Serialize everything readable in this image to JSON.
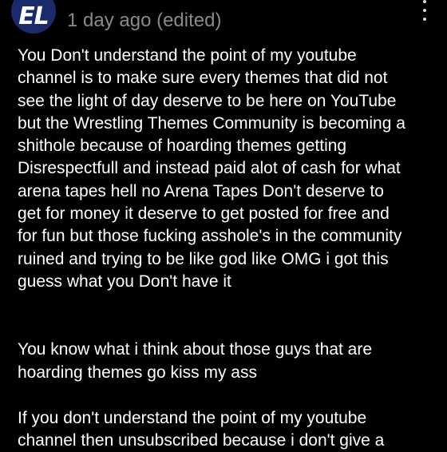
{
  "comment": {
    "avatar_initials": "EL",
    "author": "",
    "meta": "1 day ago (edited)",
    "menu_icon": "more-vertical-icon",
    "paragraphs": [
      "You Don't understand the point of my youtube\nchannel is to make sure every themes that did not\nsee the light of day deserve to be here on YouTube\nbut the Wrestling Themes Community is becoming a\nshithole because of hoarding themes getting\nDisrespectfull and instead paid alot of cash for what\narena tapes hell no Arena Tapes Don't deserve to\nget for money it deserve to get posted for free and\nfor fun but those fucking asshole's in the community\nruined and trying to be like god like OMG i got this\nguess what you Don't have it",
      "You know what i think about those guys that are\nhoarding themes go kiss my ass",
      "If you don't understand the point of my youtube\nchannel then unsubscribed because i don't give a"
    ]
  },
  "colors": {
    "background": "#000000",
    "text": "#ffffff",
    "meta": "#8a8a8a",
    "avatar": "#1a2a6b"
  }
}
